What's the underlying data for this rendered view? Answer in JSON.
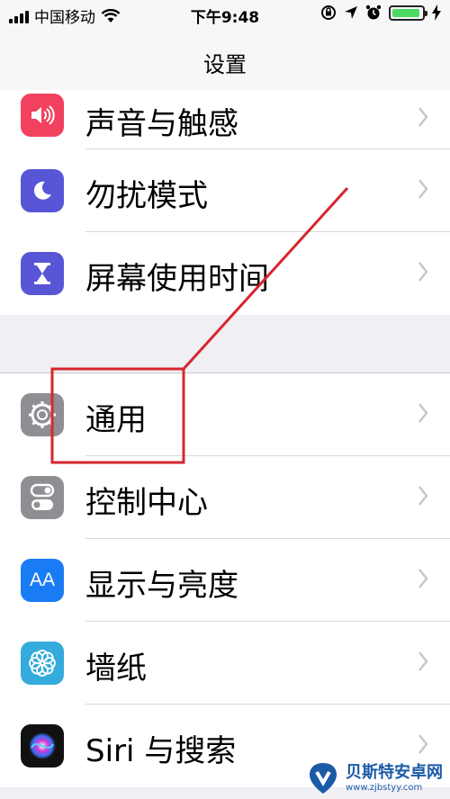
{
  "status_bar": {
    "carrier": "中国移动",
    "time": "下午9:48"
  },
  "nav": {
    "title": "设置"
  },
  "rows_group1": [
    {
      "label": "声音与触感",
      "icon": "speaker-icon",
      "color": "#f2415e"
    },
    {
      "label": "勿扰模式",
      "icon": "moon-icon",
      "color": "#5856d6"
    },
    {
      "label": "屏幕使用时间",
      "icon": "hourglass-icon",
      "color": "#5856d6"
    }
  ],
  "rows_group2": [
    {
      "label": "通用",
      "icon": "gear-icon",
      "color": "#8e8e93"
    },
    {
      "label": "控制中心",
      "icon": "toggles-icon",
      "color": "#8e8e93"
    },
    {
      "label": "显示与亮度",
      "icon": "text-size-icon",
      "color": "#1a7cf5"
    },
    {
      "label": "墙纸",
      "icon": "flower-icon",
      "color": "#35aadc"
    },
    {
      "label": "Siri 与搜索",
      "icon": "siri-icon",
      "color": "#000000"
    }
  ],
  "icon_text": {
    "display": "AA"
  },
  "annotation": {
    "color": "#d6262f"
  },
  "watermark": {
    "title": "贝斯特安卓网",
    "url": "www.zjbstyy.com"
  }
}
